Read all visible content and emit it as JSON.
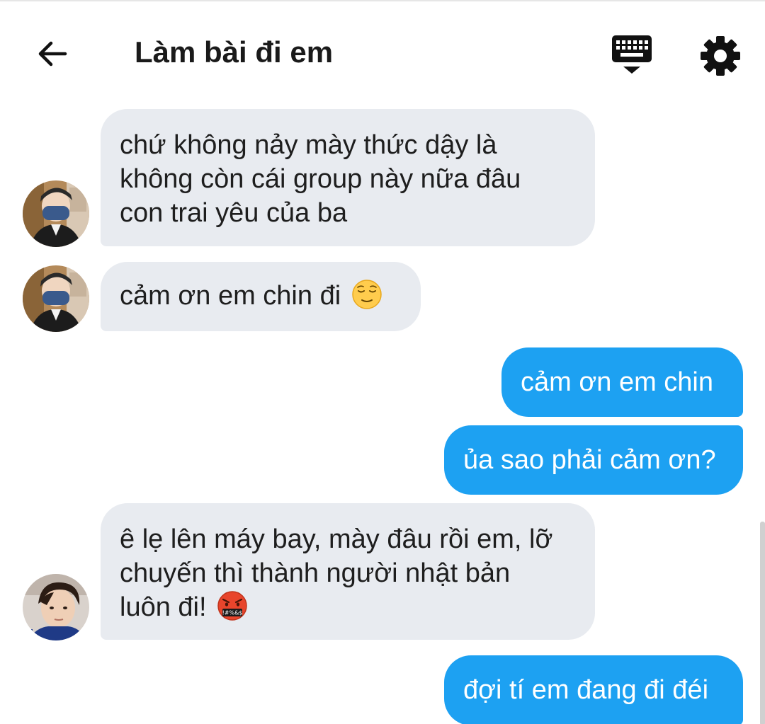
{
  "header": {
    "title": "Làm bài đi em",
    "back_icon": "arrow-left-icon",
    "keyboard_icon": "keyboard-icon",
    "settings_icon": "gear-icon"
  },
  "messages": [
    {
      "direction": "in",
      "text": "chứ không nảy mày thức dậy là\nkhông còn cái group này nữa đâu\ncon trai yêu của ba"
    },
    {
      "direction": "in",
      "text": "cảm ơn em chin đi ",
      "emoji": "relieved-face-emoji"
    },
    {
      "direction": "out",
      "text": "cảm ơn em chin"
    },
    {
      "direction": "out",
      "text": "ủa sao phải cảm ơn?"
    },
    {
      "direction": "in",
      "text": "ê lẹ lên máy bay, mày đâu rồi em, lỡ\nchuyến thì thành người nhật bản\nluôn đi! ",
      "emoji": "face-with-symbols-on-mouth-emoji"
    },
    {
      "direction": "out",
      "text": "đợi tí em đang đi đéi"
    }
  ],
  "colors": {
    "incoming_bubble": "#e8ebf0",
    "outgoing_bubble": "#1da1f2",
    "outgoing_text": "#ffffff",
    "incoming_text": "#1e1e1e"
  }
}
